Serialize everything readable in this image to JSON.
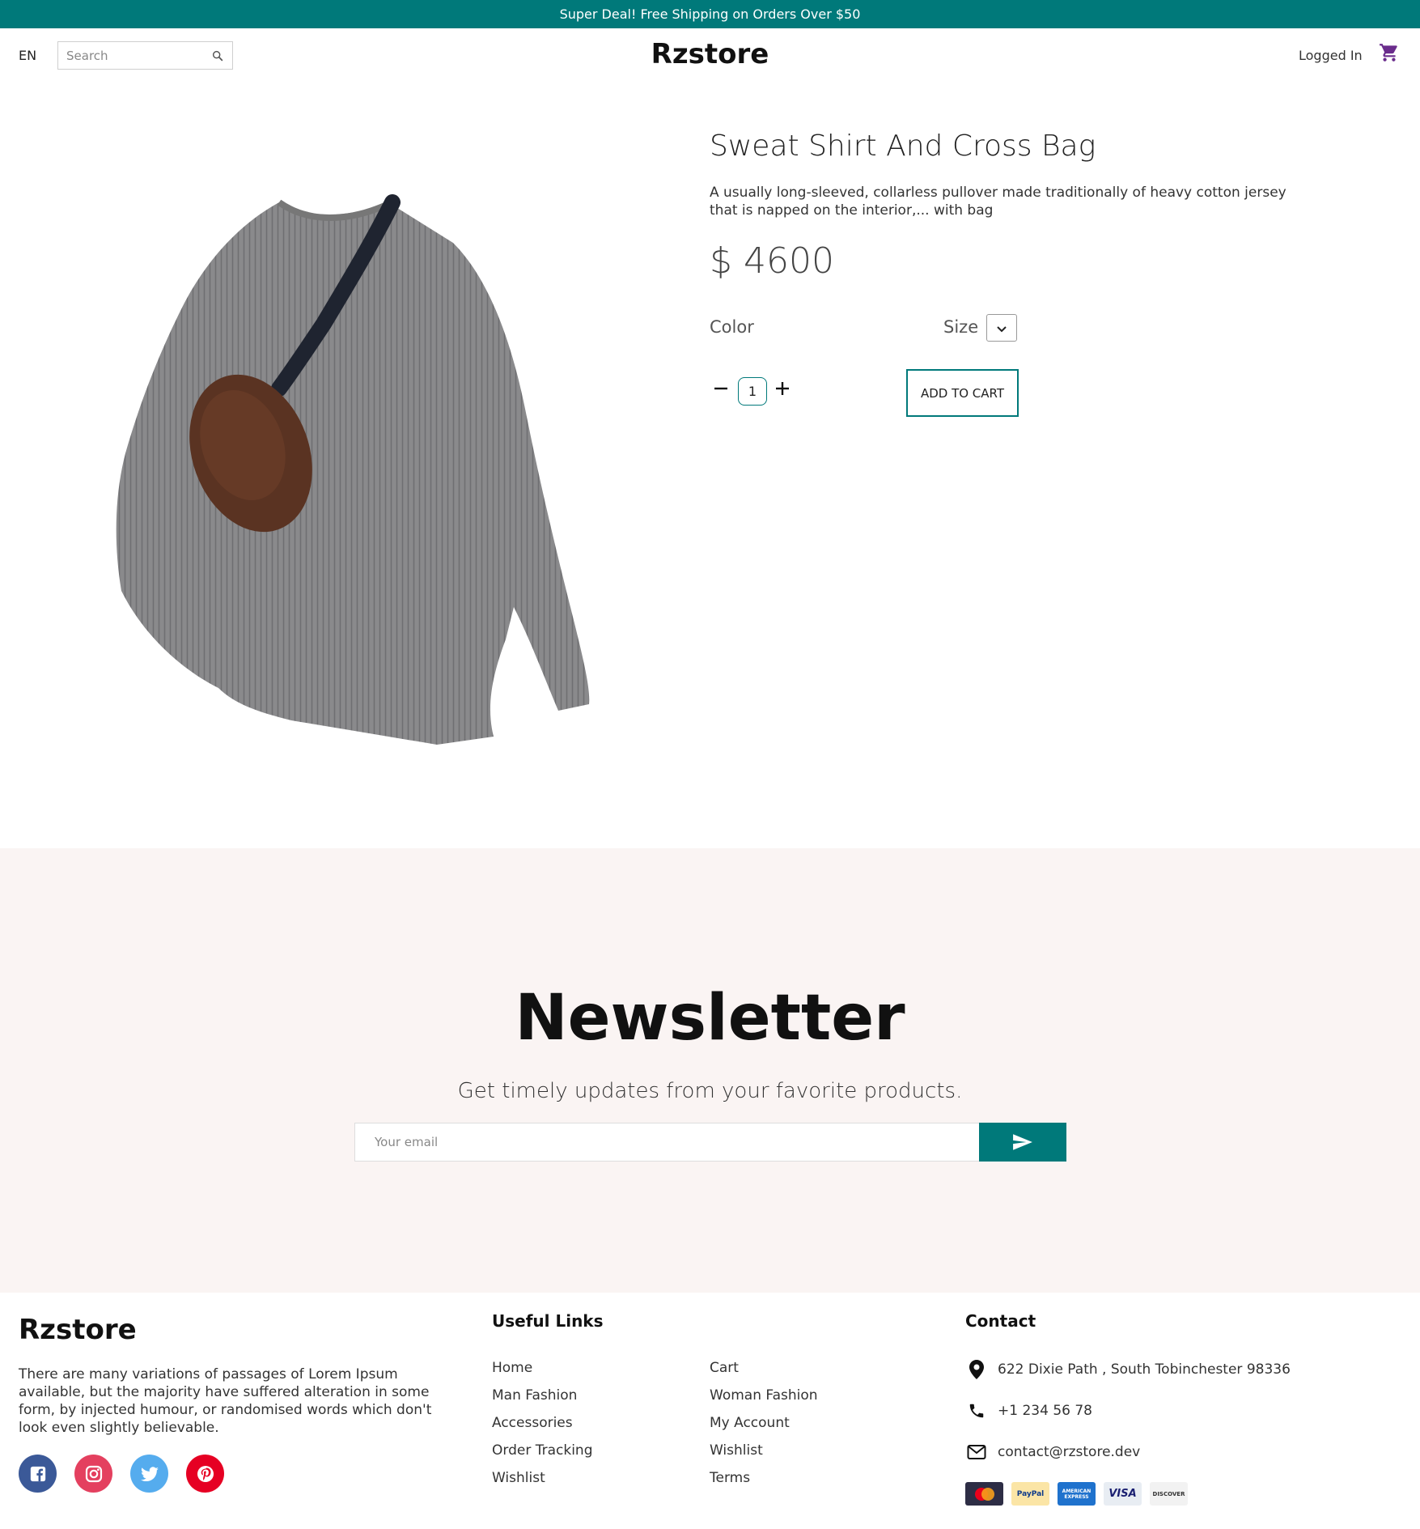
{
  "promo": {
    "text": "Super Deal! Free Shipping on Orders Over $50"
  },
  "header": {
    "language": "EN",
    "search_placeholder": "Search",
    "brand": "Rzstore",
    "login_status": "Logged In"
  },
  "product": {
    "title": "Sweat Shirt And Cross Bag",
    "description": "A usually long-sleeved, collarless pullover made traditionally of heavy cotton jersey that is napped on the interior,... with bag",
    "price": "$ 4600",
    "color_label": "Color",
    "size_label": "Size",
    "quantity": "1",
    "add_to_cart_label": "ADD TO CART"
  },
  "newsletter": {
    "title": "Newsletter",
    "subtitle": "Get timely updates from your favorite products.",
    "email_placeholder": "Your email"
  },
  "footer": {
    "brand": "Rzstore",
    "about": "There are many variations of passages of Lorem Ipsum available, but the majority have suffered alteration in some form, by injected humour, or randomised words which don't look even slightly believable.",
    "useful_links_heading": "Useful Links",
    "links_col1": [
      "Home",
      "Man Fashion",
      "Accessories",
      "Order Tracking",
      "Wishlist"
    ],
    "links_col2": [
      "Cart",
      "Woman Fashion",
      "My Account",
      "Wishlist",
      "Terms"
    ],
    "contact_heading": "Contact",
    "address": "622 Dixie Path , South Tobinchester 98336",
    "phone": "+1 234 56 78",
    "email": "contact@rzstore.dev",
    "payments": [
      "MasterCard",
      "PayPal",
      "AMERICAN EXPRESS",
      "VISA",
      "DISCOVER"
    ],
    "socials": [
      "facebook-icon",
      "instagram-icon",
      "twitter-icon",
      "pinterest-icon"
    ]
  },
  "colors": {
    "accent": "#00797a",
    "newsletter_bg": "#faf4f3",
    "cart_icon": "#6a2c8c",
    "facebook": "#3b5998",
    "instagram": "#e4405f",
    "twitter": "#55acee",
    "pinterest": "#e60023"
  }
}
